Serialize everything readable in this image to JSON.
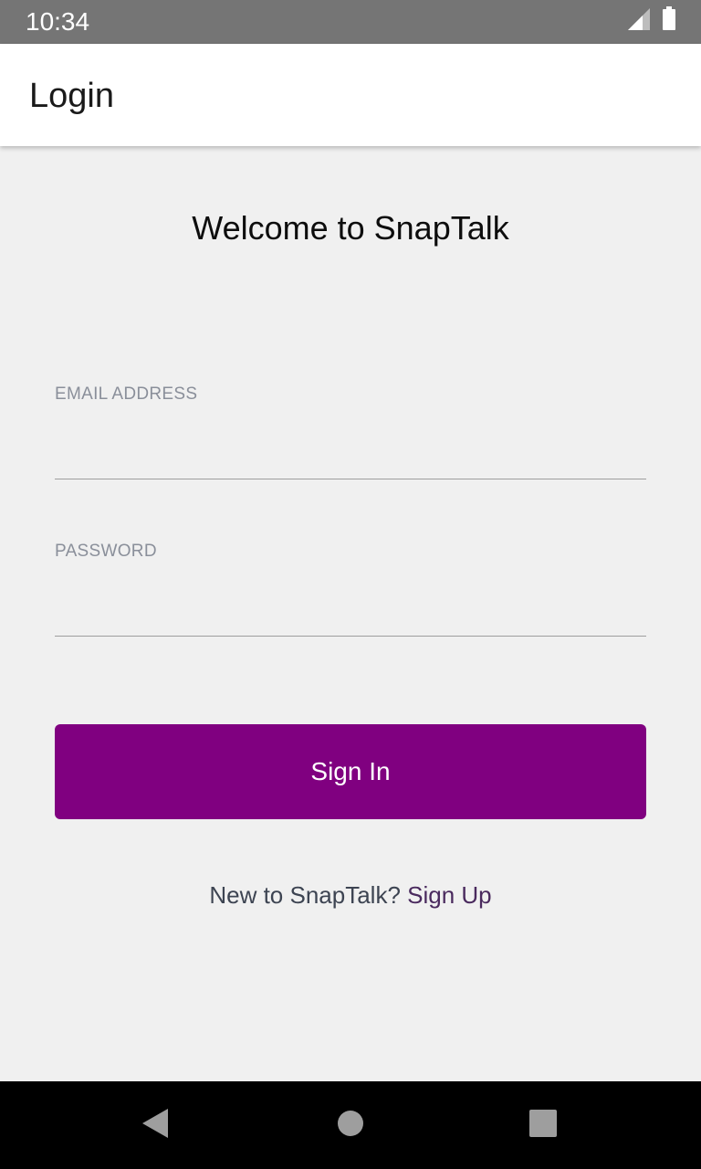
{
  "status_bar": {
    "time": "10:34",
    "icons": [
      "signal-icon",
      "battery-icon"
    ]
  },
  "app_bar": {
    "title": "Login"
  },
  "login": {
    "welcome": "Welcome to SnapTalk",
    "email_label": "EMAIL ADDRESS",
    "email_value": "",
    "password_label": "PASSWORD",
    "password_value": "",
    "signin_label": "Sign In",
    "signup_prompt": "New to SnapTalk?",
    "signup_link": "Sign Up"
  },
  "nav_bar": {
    "icons": [
      "back-icon",
      "home-icon",
      "recents-icon"
    ]
  },
  "colors": {
    "status_bar": "#757575",
    "app_bar": "#ffffff",
    "background": "#f0f0f0",
    "primary_button": "#800080",
    "nav_bar": "#000000"
  }
}
